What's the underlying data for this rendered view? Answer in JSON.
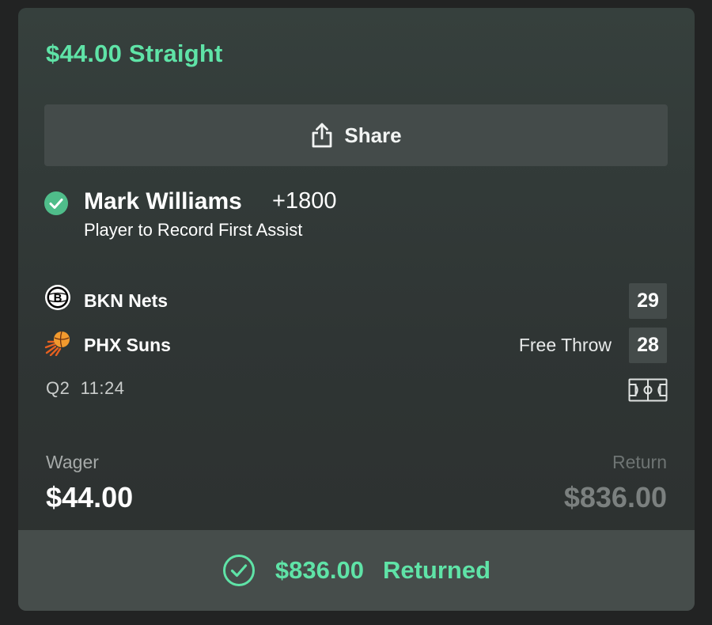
{
  "bet": {
    "title": "$44.00 Straight",
    "share_label": "Share"
  },
  "selection": {
    "player": "Mark Williams",
    "odds": "+1800",
    "market": "Player to Record First Assist",
    "status_icon": "check-circle-icon"
  },
  "game": {
    "teams": [
      {
        "name": "BKN Nets",
        "score": "29",
        "logo": "nets-logo"
      },
      {
        "name": "PHX Suns",
        "score": "28",
        "logo": "suns-logo"
      }
    ],
    "play_state": "Free Throw",
    "clock": "Q2  11:24",
    "court_icon": "basketball-court-icon"
  },
  "summary": {
    "wager_label": "Wager",
    "wager_amount": "$44.00",
    "return_label": "Return",
    "return_amount": "$836.00"
  },
  "footer": {
    "amount": "$836.00",
    "status": "Returned"
  },
  "colors": {
    "accent": "#5fe3a7",
    "background": "#222323",
    "card": "#323938",
    "button": "#444b4a"
  }
}
